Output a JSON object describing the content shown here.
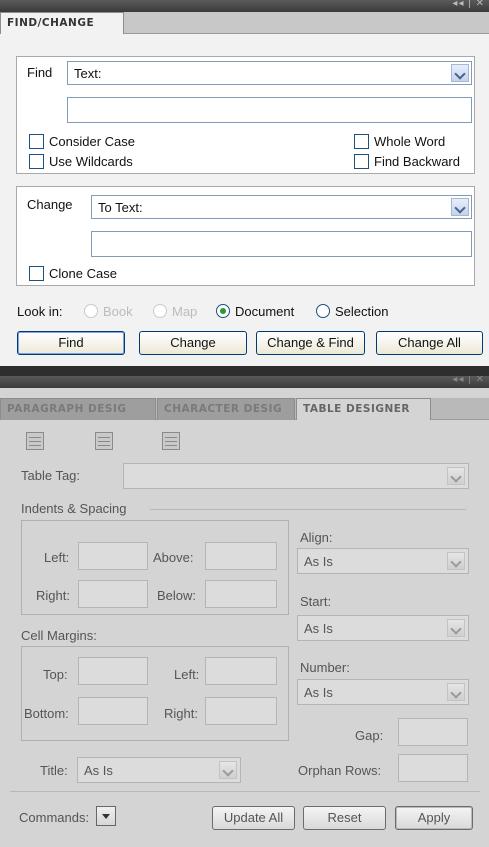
{
  "top_panel": {
    "controls": "◂◂ | ✕",
    "tab": "FIND/CHANGE",
    "find": {
      "label": "Find",
      "type_value": "Text:",
      "text_value": "",
      "consider_case": "Consider Case",
      "use_wildcards": "Use Wildcards",
      "whole_word": "Whole Word",
      "find_backward": "Find Backward"
    },
    "change": {
      "label": "Change",
      "type_value": "To Text:",
      "text_value": "",
      "clone_case": "Clone Case"
    },
    "look_in": {
      "label": "Look in:",
      "options": [
        "Book",
        "Map",
        "Document",
        "Selection"
      ],
      "selected": "Document"
    },
    "buttons": {
      "find": "Find",
      "change": "Change",
      "change_find": "Change & Find",
      "change_all": "Change All"
    }
  },
  "bottom_panel": {
    "controls": "◂◂ | ✕",
    "tabs": [
      "PARAGRAPH DESIG",
      "CHARACTER DESIG",
      "TABLE DESIGNER"
    ],
    "active_tab": "TABLE DESIGNER",
    "table_tag_label": "Table Tag:",
    "table_tag_value": "",
    "indents_spacing": {
      "heading": "Indents & Spacing",
      "left": "Left:",
      "above": "Above:",
      "right": "Right:",
      "below": "Below:"
    },
    "cell_margins": {
      "heading": "Cell Margins:",
      "top": "Top:",
      "left": "Left:",
      "bottom": "Bottom:",
      "right": "Right:"
    },
    "align": {
      "label": "Align:",
      "value": "As Is"
    },
    "start": {
      "label": "Start:",
      "value": "As Is"
    },
    "number": {
      "label": "Number:",
      "value": "As Is"
    },
    "gap_label": "Gap:",
    "title": {
      "label": "Title:",
      "value": "As Is"
    },
    "orphan_rows_label": "Orphan Rows:",
    "commands_label": "Commands:",
    "buttons": {
      "update_all": "Update All",
      "reset": "Reset",
      "apply": "Apply"
    }
  },
  "icons": [
    "table-icon",
    "table-icon",
    "table-icon",
    "dropdown-arrow-icon",
    "close-icon",
    "collapse-icon"
  ]
}
